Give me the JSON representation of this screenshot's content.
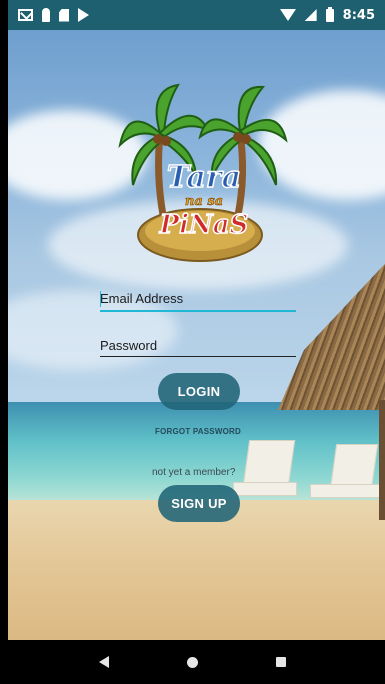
{
  "status_bar": {
    "time": "8:45",
    "left_icons": [
      "gmail-icon",
      "person-icon",
      "sd-card-icon",
      "play-store-icon"
    ],
    "right_icons": [
      "wifi-icon",
      "signal-icon",
      "battery-icon"
    ]
  },
  "logo": {
    "line1": "Tara",
    "line2": "na sa",
    "line3": "PiNaS"
  },
  "form": {
    "email_placeholder": "Email Address",
    "password_placeholder": "Password",
    "login_label": "LOGIN",
    "forgot_label": "FORGOT PASSWORD",
    "not_member_text": "not yet a member?",
    "signup_label": "SIGN UP"
  },
  "nav_bar": {
    "icons": [
      "back-icon",
      "home-icon",
      "recents-icon"
    ]
  },
  "colors": {
    "status_bar": "#1e5f70",
    "button": "#206476",
    "field_focus": "#1fb8d6"
  }
}
